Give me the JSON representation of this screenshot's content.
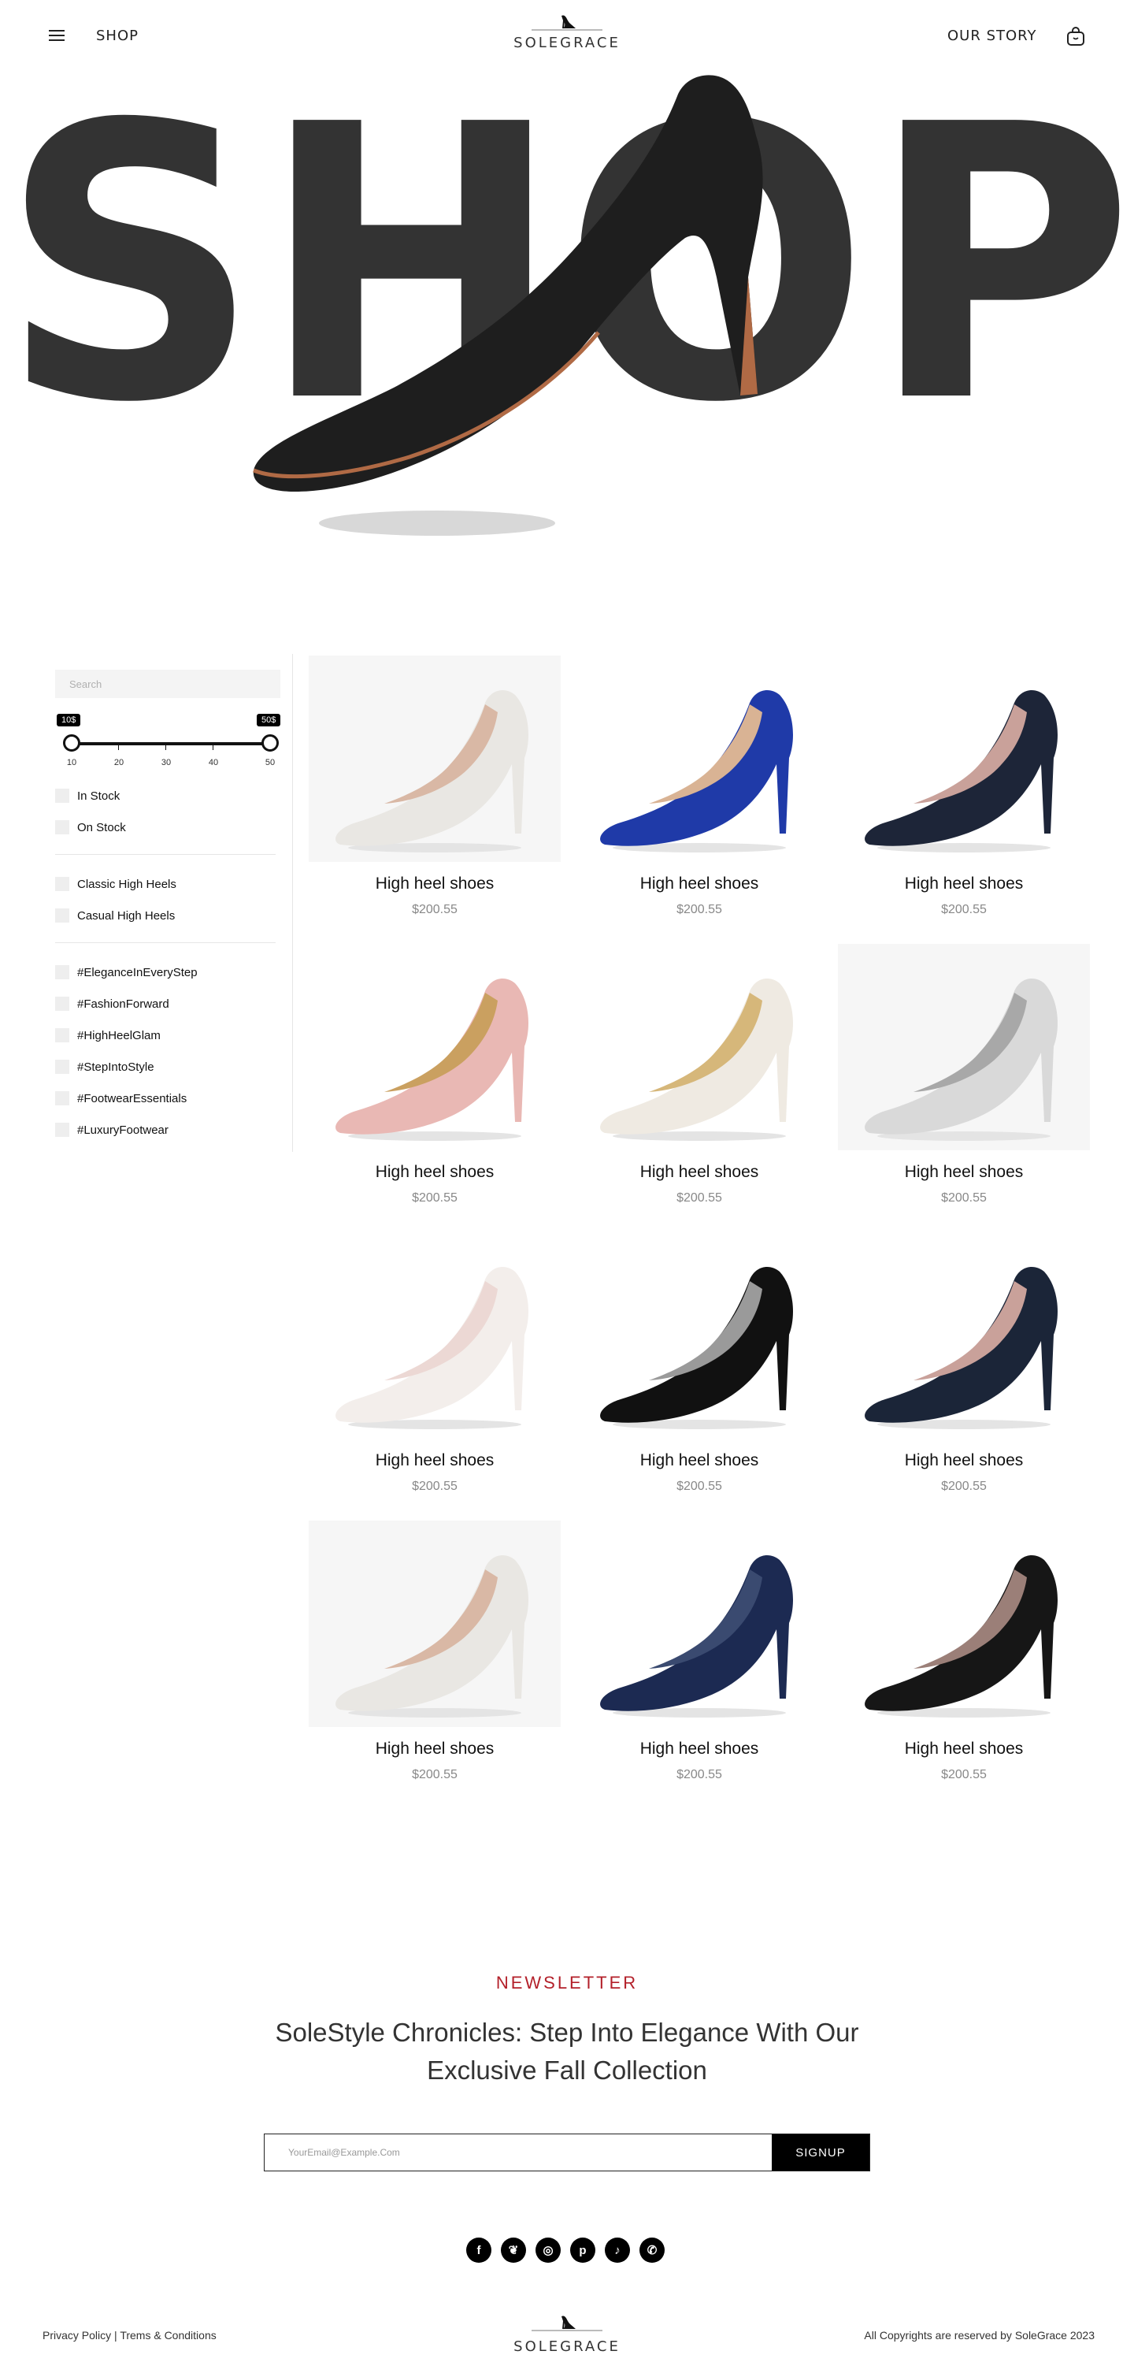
{
  "header": {
    "nav_left": "SHOP",
    "logo_text": "SOLEGRACE",
    "nav_right": "OUR STORY"
  },
  "hero": {
    "title": "SHOP",
    "title_color": "#333333",
    "shoe_color": "#1e1e1e",
    "sole_color": "#b06a45"
  },
  "sidebar": {
    "search_placeholder": "Search",
    "price": {
      "min_tag": "10$",
      "max_tag": "50$",
      "ticks": [
        "10",
        "20",
        "30",
        "40",
        "50"
      ],
      "selected_min": 10,
      "selected_max": 50
    },
    "availability": [
      {
        "label": "In Stock"
      },
      {
        "label": "On Stock"
      }
    ],
    "categories": [
      {
        "label": "Classic High Heels"
      },
      {
        "label": "Casual High Heels"
      }
    ],
    "tags": [
      {
        "label": "#EleganceInEveryStep"
      },
      {
        "label": "#FashionForward"
      },
      {
        "label": "#HighHeelGlam"
      },
      {
        "label": "#StepIntoStyle"
      },
      {
        "label": "#FootwearEssentials"
      },
      {
        "label": "#LuxuryFootwear"
      }
    ]
  },
  "products": [
    {
      "name": "High heel shoes",
      "price": "$200.55",
      "color": "#e9e7e3",
      "lining": "#d9b8a5",
      "bg": true
    },
    {
      "name": "High heel shoes",
      "price": "$200.55",
      "color": "#1f3aa8",
      "lining": "#d9b394",
      "bg": false
    },
    {
      "name": "High heel shoes",
      "price": "$200.55",
      "color": "#1d2538",
      "lining": "#c9a19a",
      "bg": false
    },
    {
      "name": "High heel shoes",
      "price": "$200.55",
      "color": "#e9b8b4",
      "lining": "#caa060",
      "bg": false
    },
    {
      "name": "High heel shoes",
      "price": "$200.55",
      "color": "#efeae2",
      "lining": "#d6b77a",
      "bg": false
    },
    {
      "name": "High heel shoes",
      "price": "$200.55",
      "color": "#d9d9d9",
      "lining": "#a8a8a8",
      "bg": true
    },
    {
      "name": "High heel shoes",
      "price": "$200.55",
      "color": "#f3eeeb",
      "lining": "#ecd8d4",
      "bg": false
    },
    {
      "name": "High heel shoes",
      "price": "$200.55",
      "color": "#111111",
      "lining": "#9a9a9a",
      "bg": false
    },
    {
      "name": "High heel shoes",
      "price": "$200.55",
      "color": "#1b2538",
      "lining": "#c9a19a",
      "bg": false
    },
    {
      "name": "High heel shoes",
      "price": "$200.55",
      "color": "#e9e7e3",
      "lining": "#d9b8a5",
      "bg": true
    },
    {
      "name": "High heel shoes",
      "price": "$200.55",
      "color": "#1c2a52",
      "lining": "#3a4a70",
      "bg": false
    },
    {
      "name": "High heel shoes",
      "price": "$200.55",
      "color": "#161616",
      "lining": "#9b7f78",
      "bg": false
    }
  ],
  "newsletter": {
    "label": "NEWSLETTER",
    "title": "SoleStyle Chronicles: Step Into Elegance With Our Exclusive Fall Collection",
    "email_placeholder": "YourEmail@Example.Com",
    "button": "SIGNUP"
  },
  "socials": [
    {
      "name": "facebook-icon",
      "glyph": "f"
    },
    {
      "name": "snapchat-icon",
      "glyph": "❦"
    },
    {
      "name": "instagram-icon",
      "glyph": "◎"
    },
    {
      "name": "pinterest-icon",
      "glyph": "p"
    },
    {
      "name": "tiktok-icon",
      "glyph": "♪"
    },
    {
      "name": "whatsapp-icon",
      "glyph": "✆"
    }
  ],
  "footer": {
    "privacy": "Privacy Policy",
    "separator": "|",
    "terms": "Trems & Conditions",
    "logo_text": "SOLEGRACE",
    "copyright": "All Copyrights are reserved by SoleGrace 2023"
  },
  "colors": {
    "accent": "#b3202a",
    "dark": "#000000"
  }
}
